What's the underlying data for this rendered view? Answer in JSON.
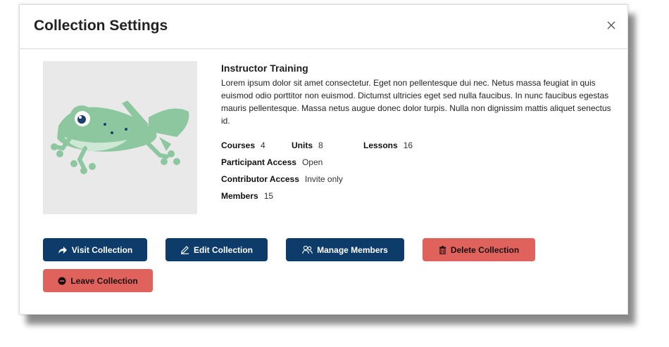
{
  "modal": {
    "title": "Collection Settings",
    "close_icon": "close-icon"
  },
  "collection": {
    "image_icon": "frog-illustration",
    "name": "Instructor Training",
    "description": "Lorem ipsum dolor sit amet consectetur. Eget non pellentesque dui nec. Netus massa feugiat in quis euismod odio porttitor non euismod. Dictumst ultricies eget sed nulla faucibus. In nunc faucibus egestas mauris pellentesque. Massa netus augue donec dolor turpis. Nulla non dignissim mattis aliquet senectus id.",
    "courses_label": "Courses",
    "courses_value": "4",
    "units_label": "Units",
    "units_value": "8",
    "lessons_label": "Lessons",
    "lessons_value": "16",
    "participant_label": "Participant Access",
    "participant_value": "Open",
    "contributor_label": "Contributor Access",
    "contributor_value": "Invite only",
    "members_label": "Members",
    "members_value": "15"
  },
  "actions": {
    "visit_label": "Visit Collection",
    "edit_label": "Edit Collection",
    "manage_label": "Manage Members",
    "delete_label": "Delete Collection",
    "leave_label": "Leave Collection"
  },
  "colors": {
    "primary": "#0d3c6b",
    "danger": "#e0625c",
    "frog_green": "#8cc7a0",
    "frog_dark": "#1d3f6e"
  }
}
